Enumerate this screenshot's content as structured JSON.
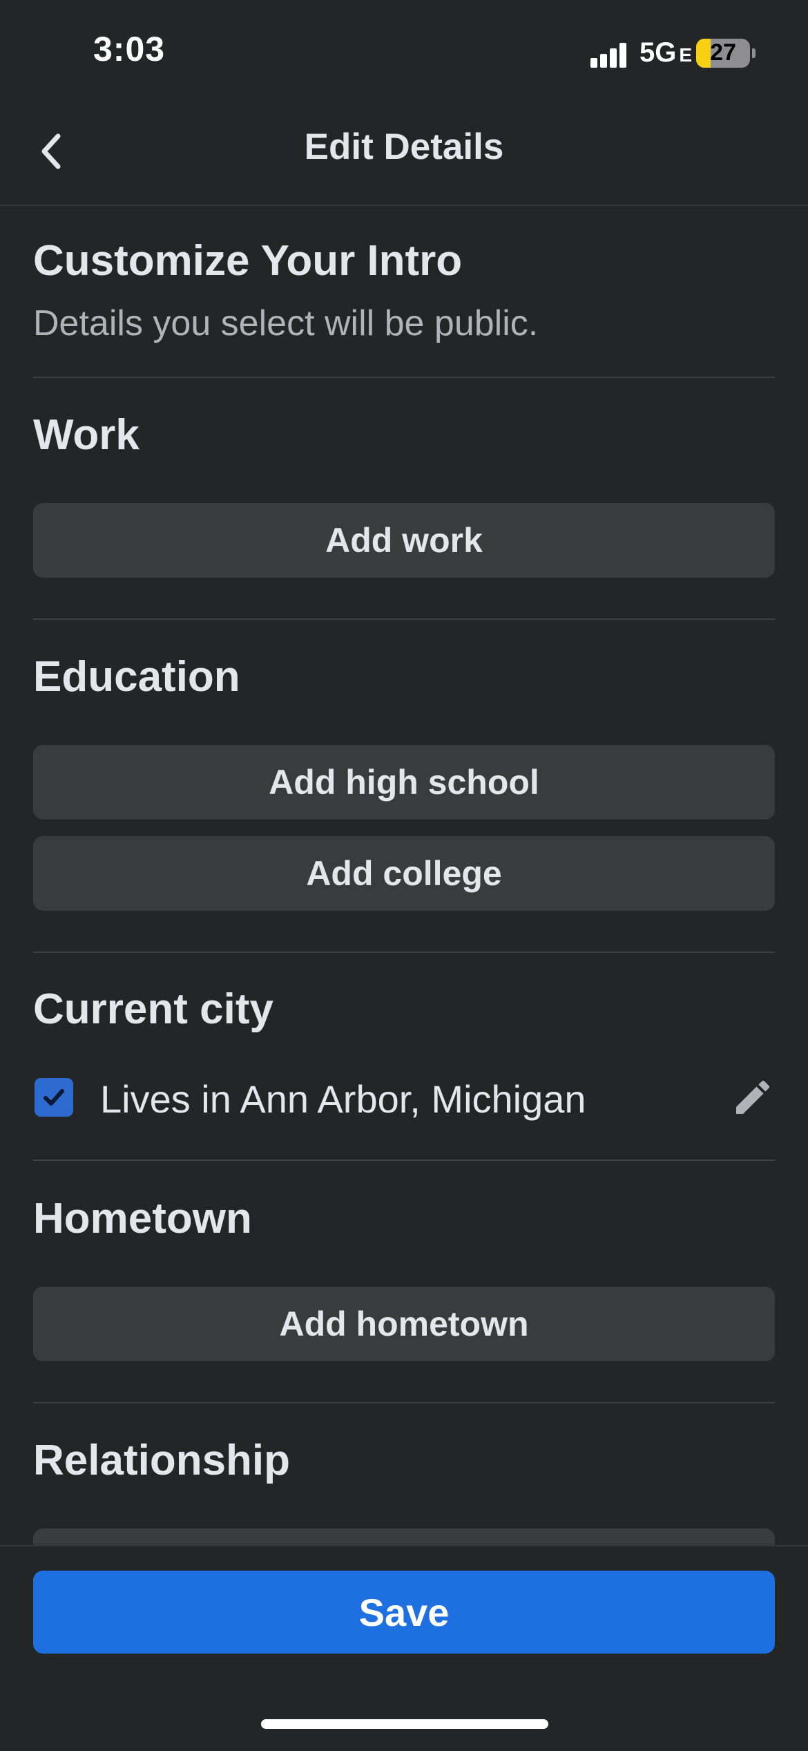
{
  "status_bar": {
    "time": "3:03",
    "network": "5G",
    "network_suffix": "E",
    "battery": "27",
    "battery_level": 0.27
  },
  "nav": {
    "title": "Edit Details",
    "back_icon": "chevron-left-icon"
  },
  "intro": {
    "heading": "Customize Your Intro",
    "subtitle": "Details you select will be public."
  },
  "work": {
    "title": "Work",
    "add_label": "Add work"
  },
  "education": {
    "title": "Education",
    "high_school_label": "Add high school",
    "college_label": "Add college"
  },
  "current_city": {
    "title": "Current city",
    "value": "Lives in Ann Arbor, Michigan",
    "checked": true,
    "edit_icon": "pencil-icon"
  },
  "hometown": {
    "title": "Hometown",
    "add_label": "Add hometown"
  },
  "relationship": {
    "title": "Relationship"
  },
  "footer": {
    "save_label": "Save"
  },
  "colors": {
    "background": "#242527",
    "button": "#3a3b3c",
    "accent": "#1e6fe0",
    "checkbox": "#2d6bd1"
  }
}
